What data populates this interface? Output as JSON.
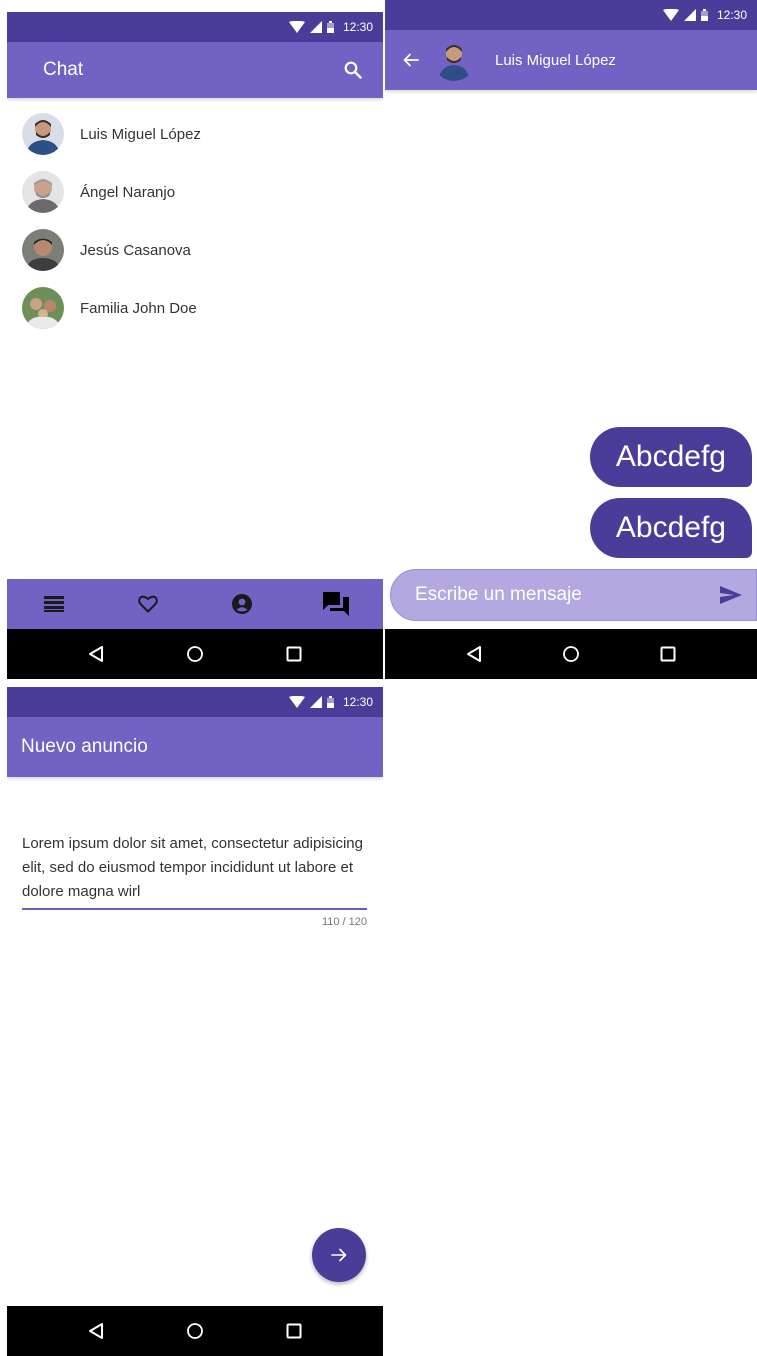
{
  "status_bar": {
    "time": "12:30"
  },
  "chat_list": {
    "title": "Chat",
    "items": [
      {
        "name": "Luis Miguel López"
      },
      {
        "name": "Ángel Naranjo"
      },
      {
        "name": "Jesús Casanova"
      },
      {
        "name": "Familia John Doe"
      }
    ]
  },
  "conversation": {
    "contact_name": "Luis Miguel López",
    "messages": [
      {
        "text": "Abcdefg"
      },
      {
        "text": "Abcdefg"
      }
    ],
    "input_placeholder": "Escribe un mensaje"
  },
  "new_ad": {
    "title": "Nuevo anuncio",
    "text": "Lorem ipsum dolor sit amet, consectetur adipisicing elit, sed do eiusmod tempor incididunt ut labore et dolore magna wirl",
    "counter": "110 / 120"
  },
  "colors": {
    "status_bar": "#4a3d9a",
    "app_bar": "#7162c4",
    "accent": "#4a3d9a",
    "composer": "#b3a9e0"
  },
  "icons": {
    "search": "search-icon",
    "back": "arrow-back-icon",
    "send": "send-icon",
    "forward": "arrow-forward-icon",
    "nav_list": "list-icon",
    "nav_favorites": "heart-icon",
    "nav_profile": "account-circle-icon",
    "nav_chat": "forum-icon"
  }
}
